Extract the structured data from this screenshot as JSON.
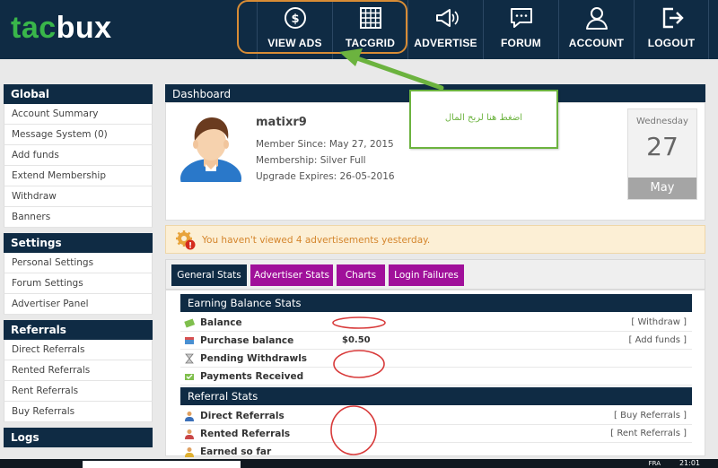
{
  "header": {
    "logo_a": "tac",
    "logo_b": "bux",
    "nav": [
      {
        "label": "VIEW ADS",
        "icon": "dollar-circle-icon"
      },
      {
        "label": "TACGRID",
        "icon": "grid-icon"
      },
      {
        "label": "ADVERTISE",
        "icon": "megaphone-icon"
      },
      {
        "label": "FORUM",
        "icon": "chat-bubble-icon"
      },
      {
        "label": "ACCOUNT",
        "icon": "user-icon"
      },
      {
        "label": "LOGOUT",
        "icon": "logout-icon"
      }
    ]
  },
  "sidebar": {
    "groups": [
      {
        "title": "Global",
        "items": [
          "Account Summary",
          "Message System (0)",
          "Add funds",
          "Extend Membership",
          "Withdraw",
          "Banners"
        ]
      },
      {
        "title": "Settings",
        "items": [
          "Personal Settings",
          "Forum Settings",
          "Advertiser Panel"
        ]
      },
      {
        "title": "Referrals",
        "items": [
          "Direct Referrals",
          "Rented Referrals",
          "Rent Referrals",
          "Buy Referrals"
        ]
      },
      {
        "title": "Logs",
        "items": []
      }
    ]
  },
  "dashboard": {
    "title": "Dashboard",
    "username": "matixr9",
    "member_since": "Member Since: May 27, 2015",
    "membership": "Membership: Silver Full",
    "upgrade_expires": "Upgrade Expires: 26-05-2016",
    "calendar": {
      "weekday": "Wednesday",
      "day": "27",
      "month": "May"
    },
    "alert": "You haven't viewed 4 advertisements yesterday.",
    "tabs": [
      {
        "label": "General Stats",
        "color": "#0f2b44"
      },
      {
        "label": "Advertiser Stats",
        "color": "#a0109a"
      },
      {
        "label": "Charts",
        "color": "#a0109a"
      },
      {
        "label": "Login Failures",
        "color": "#a0109a"
      }
    ],
    "earning_title": "Earning Balance Stats",
    "earning_rows": [
      {
        "label": "Balance",
        "value": "",
        "action": "[ Withdraw ]"
      },
      {
        "label": "Purchase balance",
        "value": "$0.50",
        "action": "[ Add funds ]"
      },
      {
        "label": "Pending Withdrawls",
        "value": "",
        "action": ""
      },
      {
        "label": "Payments Received",
        "value": "",
        "action": ""
      }
    ],
    "referral_title": "Referral Stats",
    "referral_rows": [
      {
        "label": "Direct Referrals",
        "value": "",
        "action": "[ Buy Referrals ]"
      },
      {
        "label": "Rented Referrals",
        "value": "",
        "action": "[ Rent Referrals ]"
      },
      {
        "label": "Earned so far",
        "value": "",
        "action": ""
      }
    ]
  },
  "annotation": {
    "callout_text": "اضغط هنا لربح المال"
  },
  "taskbar": {
    "lang": "FRA",
    "time": "21:01"
  },
  "colors": {
    "navy": "#0f2b44",
    "green": "#39b54a",
    "purple": "#a0109a",
    "orange": "#d88c35"
  }
}
